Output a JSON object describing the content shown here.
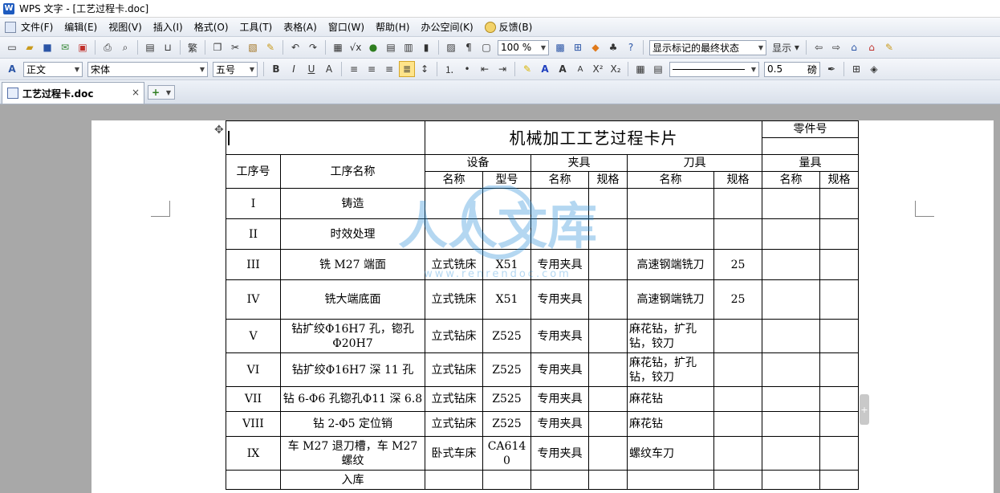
{
  "window": {
    "title": "WPS 文字 - [工艺过程卡.doc]",
    "app_icon_label": "W"
  },
  "menu": [
    {
      "label": "文件(F)"
    },
    {
      "label": "编辑(E)"
    },
    {
      "label": "视图(V)"
    },
    {
      "label": "插入(I)"
    },
    {
      "label": "格式(O)"
    },
    {
      "label": "工具(T)"
    },
    {
      "label": "表格(A)"
    },
    {
      "label": "窗口(W)"
    },
    {
      "label": "帮助(H)"
    },
    {
      "label": "办公空间(K)"
    },
    {
      "label": "反馈(B)"
    }
  ],
  "toolbar1": {
    "zoom": "100 %",
    "markup_state": "显示标记的最终状态",
    "show_label": "显示"
  },
  "toolbar2": {
    "style": "正文",
    "font": "宋体",
    "size": "五号",
    "line_width": "0.5",
    "line_unit": "磅"
  },
  "tabs": {
    "doc_tab": "工艺过程卡.doc",
    "close": "×",
    "new": "+"
  },
  "table": {
    "title": "机械加工工艺过程卡片",
    "part_no_label": "零件号",
    "h_seq": "工序号",
    "h_name": "工序名称",
    "h_equipment": "设备",
    "h_fixture": "夹具",
    "h_tool": "刀具",
    "h_gauge": "量具",
    "h_sub_name": "名称",
    "h_sub_model": "型号",
    "h_sub_spec": "规格",
    "rows": [
      {
        "seq": "I",
        "name": "铸造",
        "eq_name": "",
        "eq_model": "",
        "fx_name": "",
        "fx_spec": "",
        "tool_name": "",
        "tool_spec": ""
      },
      {
        "seq": "II",
        "name": "时效处理",
        "eq_name": "",
        "eq_model": "",
        "fx_name": "",
        "fx_spec": "",
        "tool_name": "",
        "tool_spec": ""
      },
      {
        "seq": "III",
        "name": "铣 M27 端面",
        "eq_name": "立式铣床",
        "eq_model": "X51",
        "fx_name": "专用夹具",
        "fx_spec": "",
        "tool_name": "高速钢端铣刀",
        "tool_spec": "25"
      },
      {
        "seq": "IV",
        "name": "铣大端底面",
        "eq_name": "立式铣床",
        "eq_model": "X51",
        "fx_name": "专用夹具",
        "fx_spec": "",
        "tool_name": "高速钢端铣刀",
        "tool_spec": "25"
      },
      {
        "seq": "V",
        "name": "钻扩绞Φ16H7 孔，锪孔Φ20H7",
        "eq_name": "立式钻床",
        "eq_model": "Z525",
        "fx_name": "专用夹具",
        "fx_spec": "",
        "tool_name": "麻花钻，扩孔钻，铰刀",
        "tool_spec": ""
      },
      {
        "seq": "VI",
        "name": "钻扩绞Φ16H7 深 11 孔",
        "eq_name": "立式钻床",
        "eq_model": "Z525",
        "fx_name": "专用夹具",
        "fx_spec": "",
        "tool_name": "麻花钻，扩孔钻，铰刀",
        "tool_spec": ""
      },
      {
        "seq": "VII",
        "name": "钻 6-Φ6 孔锪孔Φ11 深 6.8",
        "eq_name": "立式钻床",
        "eq_model": "Z525",
        "fx_name": "专用夹具",
        "fx_spec": "",
        "tool_name": "麻花钻",
        "tool_spec": ""
      },
      {
        "seq": "VIII",
        "name": "钻 2-Φ5 定位销",
        "eq_name": "立式钻床",
        "eq_model": "Z525",
        "fx_name": "专用夹具",
        "fx_spec": "",
        "tool_name": "麻花钻",
        "tool_spec": ""
      },
      {
        "seq": "IX",
        "name": "车 M27 退刀槽，车 M27 螺纹",
        "eq_name": "卧式车床",
        "eq_model": "CA6140",
        "fx_name": "专用夹具",
        "fx_spec": "",
        "tool_name": "螺纹车刀",
        "tool_spec": ""
      },
      {
        "seq": "",
        "name": "入库",
        "eq_name": "",
        "eq_model": "",
        "fx_name": "",
        "fx_spec": "",
        "tool_name": "",
        "tool_spec": ""
      }
    ]
  },
  "watermark": {
    "text": "人人文库",
    "url": "www.renrendoc.com",
    "color": "#2a8fd8"
  }
}
